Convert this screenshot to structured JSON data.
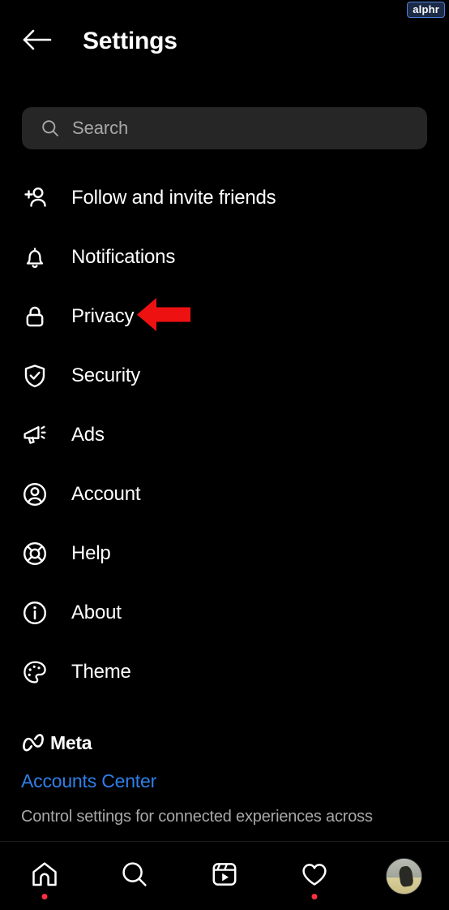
{
  "watermark": {
    "text": "alphr"
  },
  "header": {
    "back_icon": "back-arrow-icon",
    "title": "Settings"
  },
  "search": {
    "icon": "search-icon",
    "placeholder": "Search",
    "value": ""
  },
  "menu": {
    "items": [
      {
        "label": "Follow and invite friends",
        "icon": "person-add-icon"
      },
      {
        "label": "Notifications",
        "icon": "bell-icon"
      },
      {
        "label": "Privacy",
        "icon": "lock-icon"
      },
      {
        "label": "Security",
        "icon": "shield-check-icon"
      },
      {
        "label": "Ads",
        "icon": "megaphone-icon"
      },
      {
        "label": "Account",
        "icon": "account-circle-icon"
      },
      {
        "label": "Help",
        "icon": "life-ring-icon"
      },
      {
        "label": "About",
        "icon": "info-circle-icon"
      },
      {
        "label": "Theme",
        "icon": "palette-icon"
      }
    ]
  },
  "annotation": {
    "arrow_color": "#ee1111",
    "points_at": "Privacy"
  },
  "meta": {
    "logo_icon": "meta-infinity-icon",
    "brand": "Meta",
    "accounts_center_label": "Accounts Center",
    "accounts_center_color": "#2f7fe8",
    "description": "Control settings for connected experiences across"
  },
  "bottom_nav": {
    "items": [
      {
        "name": "home",
        "icon": "home-icon",
        "badge": true
      },
      {
        "name": "search",
        "icon": "search-icon",
        "badge": false
      },
      {
        "name": "reels",
        "icon": "reels-icon",
        "badge": false
      },
      {
        "name": "activity",
        "icon": "heart-icon",
        "badge": true
      },
      {
        "name": "profile",
        "icon": "avatar-icon",
        "badge": false
      }
    ],
    "badge_color": "#ff3040"
  }
}
